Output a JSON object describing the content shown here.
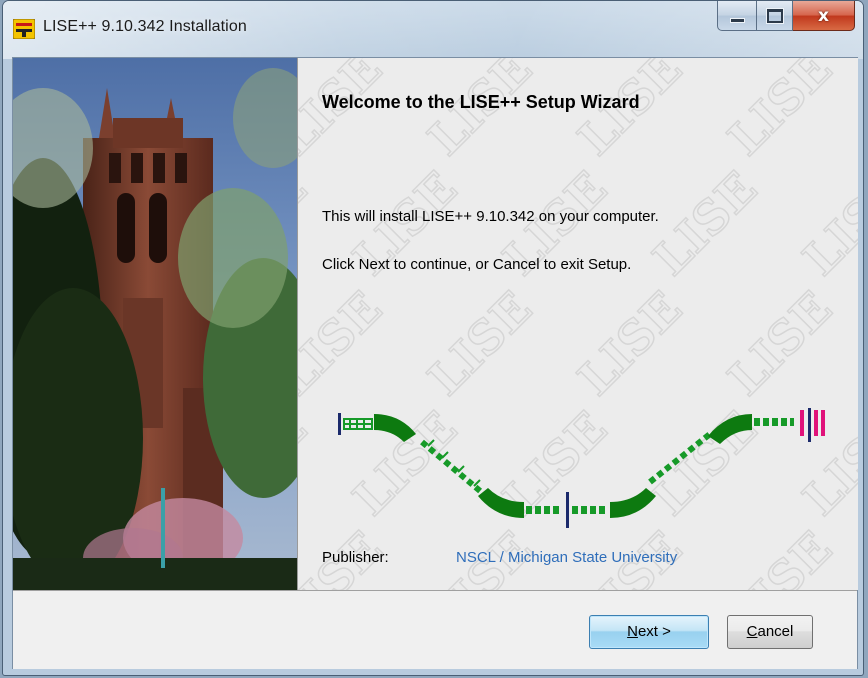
{
  "window": {
    "title": "LISE++ 9.10.342 Installation",
    "icon": "lise-app-icon",
    "controls": {
      "minimize": "minimize-icon",
      "maximize": "maximize-icon",
      "close_glyph": "x"
    }
  },
  "wizard": {
    "heading": "Welcome to the LISE++ Setup Wizard",
    "line1": "This will install LISE++ 9.10.342 on your computer.",
    "line2": "Click Next to continue, or Cancel to exit Setup.",
    "publisher_label": "Publisher:",
    "publisher_value": "NSCL / Michigan State University",
    "watermark_text": "LISE"
  },
  "buttons": {
    "next_mnemonic": "N",
    "next_rest": "ext >",
    "cancel_mnemonic": "C",
    "cancel_rest": "ancel"
  },
  "colors": {
    "magnet_green": "#0d7a10",
    "quad_green": "#169a28",
    "detector_blue": "#1b2a6b",
    "detector_pink": "#e0127a",
    "link_blue": "#2f6eba"
  }
}
